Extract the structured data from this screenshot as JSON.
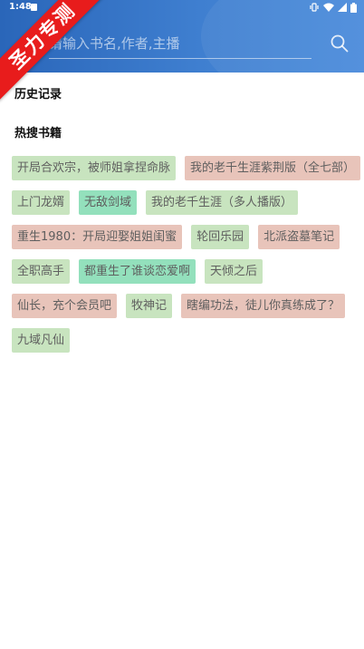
{
  "status_bar": {
    "time": "1:48"
  },
  "watermark": "圣力专测",
  "search": {
    "placeholder": "请输入书名,作者,主播"
  },
  "sections": {
    "history_title": "历史记录",
    "hot_title": "热搜书籍"
  },
  "colors": {
    "header": "#2f6fc4",
    "tag_green": "#c8e4bf",
    "tag_pink": "#e8c4ba",
    "tag_teal": "#93e0bc",
    "ribbon": "#e81c1c"
  },
  "hot_books": [
    {
      "label": "开局合欢宗，被师姐拿捏命脉",
      "color": "#c8e4bf"
    },
    {
      "label": "我的老千生涯紫荆版（全七部）",
      "color": "#e8c4ba"
    },
    {
      "label": "上门龙婿",
      "color": "#c8e4bf"
    },
    {
      "label": "无敌剑域",
      "color": "#93e0bc"
    },
    {
      "label": "我的老千生涯（多人播版）",
      "color": "#c8e4bf"
    },
    {
      "label": "重生1980：开局迎娶姐姐闺蜜",
      "color": "#e8c4ba"
    },
    {
      "label": "轮回乐园",
      "color": "#c8e4bf"
    },
    {
      "label": "北派盗墓笔记",
      "color": "#e8c4ba"
    },
    {
      "label": "全职高手",
      "color": "#c8e4bf"
    },
    {
      "label": "都重生了谁谈恋爱啊",
      "color": "#93e0bc"
    },
    {
      "label": "天倾之后",
      "color": "#c8e4bf"
    },
    {
      "label": "仙长，充个会员吧",
      "color": "#e8c4ba"
    },
    {
      "label": "牧神记",
      "color": "#c8e4bf"
    },
    {
      "label": "瞎编功法，徒儿你真练成了？",
      "color": "#e8c4ba"
    },
    {
      "label": "九域凡仙",
      "color": "#c8e4bf"
    }
  ]
}
